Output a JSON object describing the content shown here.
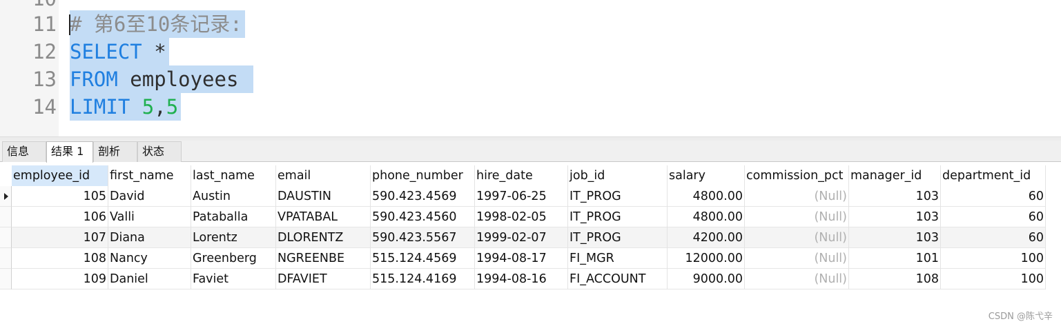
{
  "editor": {
    "partial_line_number": "10",
    "lines": [
      {
        "number": "11",
        "tokens": [
          {
            "text": "# 第6至10条记录:",
            "kind": "comment"
          }
        ]
      },
      {
        "number": "12",
        "tokens": [
          {
            "text": "SELECT",
            "kind": "kw"
          },
          {
            "text": " *",
            "kind": "plain"
          }
        ]
      },
      {
        "number": "13",
        "tokens": [
          {
            "text": "FROM",
            "kind": "kw"
          },
          {
            "text": " employees ",
            "kind": "plain"
          }
        ]
      },
      {
        "number": "14",
        "tokens": [
          {
            "text": "LIMIT",
            "kind": "kw"
          },
          {
            "text": " ",
            "kind": "plain"
          },
          {
            "text": "5",
            "kind": "num"
          },
          {
            "text": ",",
            "kind": "plain"
          },
          {
            "text": "5",
            "kind": "num"
          }
        ]
      }
    ]
  },
  "tabs": [
    {
      "label": "信息",
      "active": false
    },
    {
      "label": "结果 1",
      "active": true
    },
    {
      "label": "剖析",
      "active": false
    },
    {
      "label": "状态",
      "active": false
    }
  ],
  "grid": {
    "columns": [
      "employee_id",
      "first_name",
      "last_name",
      "email",
      "phone_number",
      "hire_date",
      "job_id",
      "salary",
      "commission_pct",
      "manager_id",
      "department_id"
    ],
    "selected_column": "employee_id",
    "current_row": 0,
    "rows": [
      [
        "105",
        "David",
        "Austin",
        "DAUSTIN",
        "590.423.4569",
        "1997-06-25",
        "IT_PROG",
        "4800.00",
        "(Null)",
        "103",
        "60"
      ],
      [
        "106",
        "Valli",
        "Pataballa",
        "VPATABAL",
        "590.423.4560",
        "1998-02-05",
        "IT_PROG",
        "4800.00",
        "(Null)",
        "103",
        "60"
      ],
      [
        "107",
        "Diana",
        "Lorentz",
        "DLORENTZ",
        "590.423.5567",
        "1999-02-07",
        "IT_PROG",
        "4200.00",
        "(Null)",
        "103",
        "60"
      ],
      [
        "108",
        "Nancy",
        "Greenberg",
        "NGREENBE",
        "515.124.4569",
        "1994-08-17",
        "FI_MGR",
        "12000.00",
        "(Null)",
        "101",
        "100"
      ],
      [
        "109",
        "Daniel",
        "Faviet",
        "DFAVIET",
        "515.124.4169",
        "1994-08-16",
        "FI_ACCOUNT",
        "9000.00",
        "(Null)",
        "108",
        "100"
      ]
    ]
  },
  "watermark": "CSDN @陈弋辛",
  "colors": {
    "keyword": "#1f7fe0",
    "comment": "#8c8c8c",
    "number": "#20b050",
    "selection": "#c3dcf5",
    "null_text": "#b0b0b0"
  }
}
